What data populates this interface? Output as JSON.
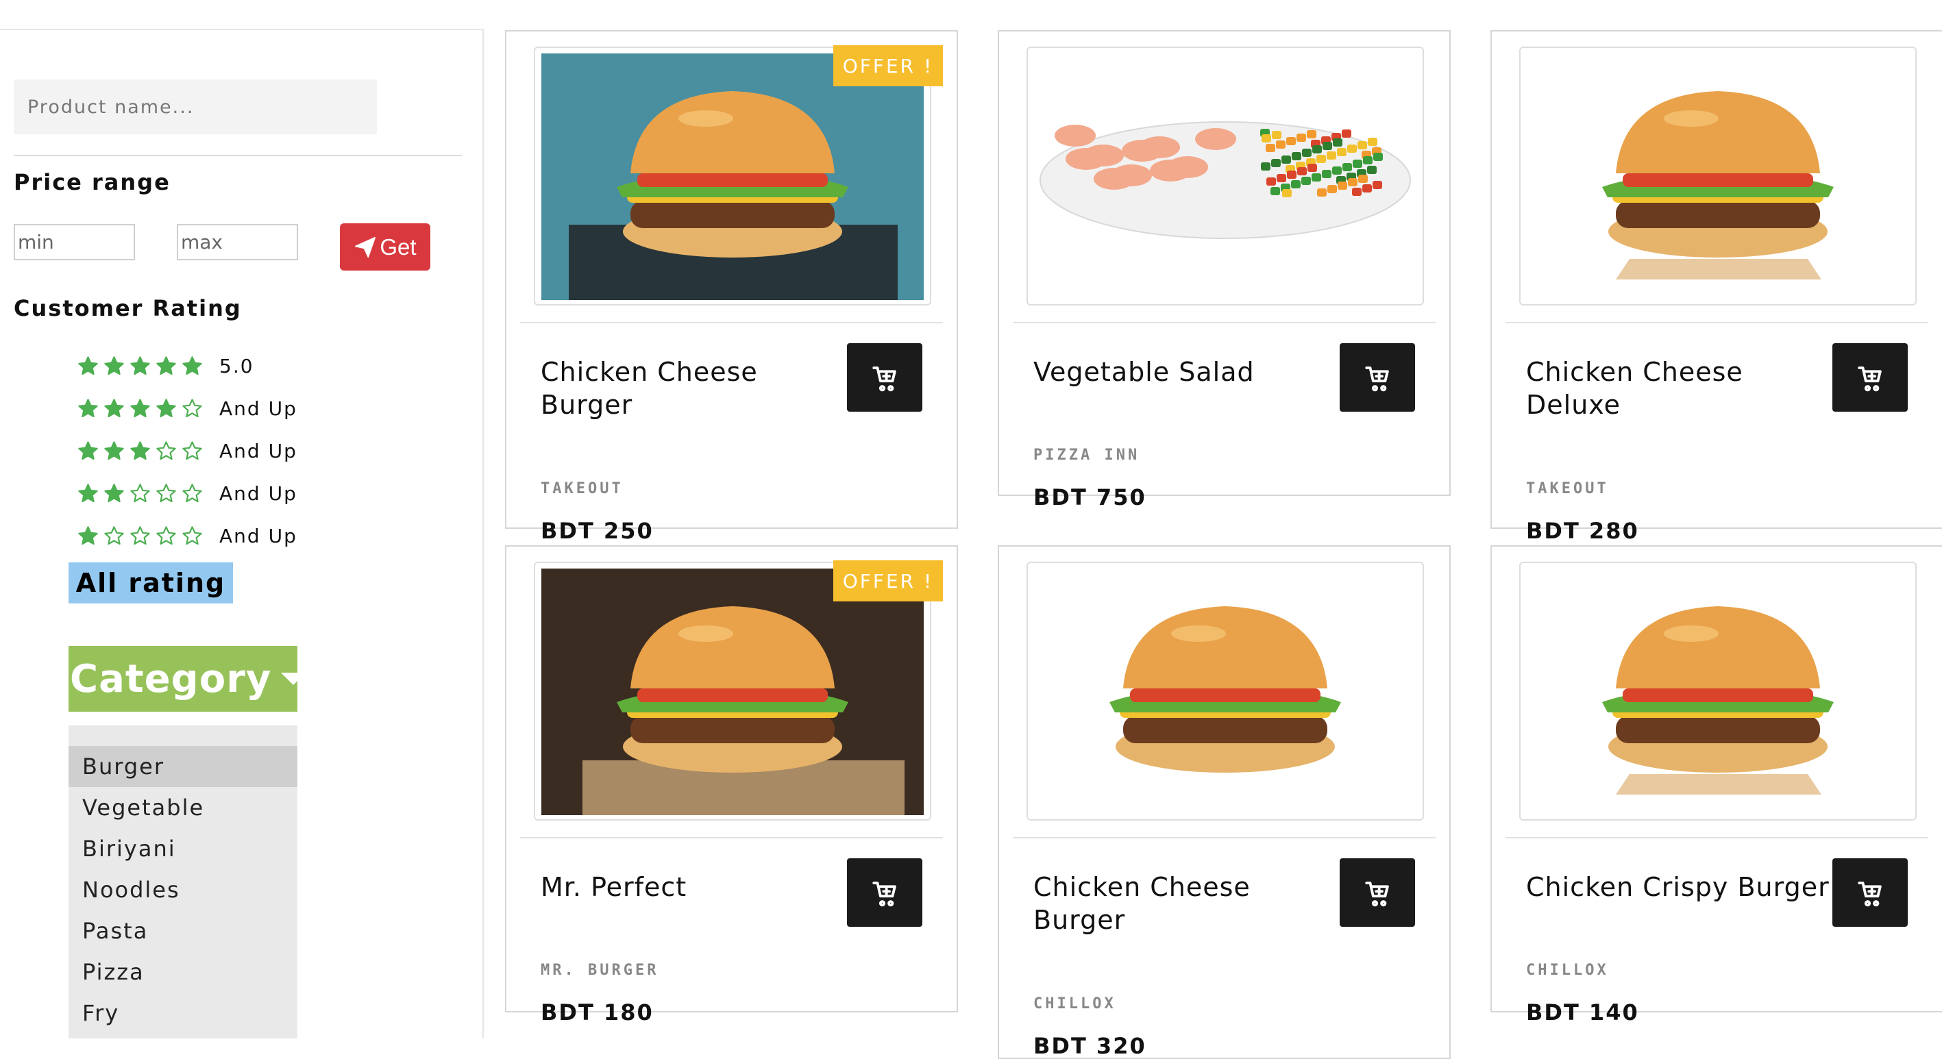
{
  "search": {
    "placeholder": "Product name..."
  },
  "price_range": {
    "title": "Price range",
    "min_placeholder": "min",
    "max_placeholder": "max",
    "button_label": "Get"
  },
  "rating": {
    "title": "Customer Rating",
    "rows": [
      {
        "stars": 5,
        "label": "5.0"
      },
      {
        "stars": 4,
        "label": "And Up"
      },
      {
        "stars": 3,
        "label": "And Up"
      },
      {
        "stars": 2,
        "label": "And Up"
      },
      {
        "stars": 1,
        "label": "And Up"
      }
    ],
    "all_label": "All rating"
  },
  "category": {
    "title": "Category",
    "items": [
      "Burger",
      "Vegetable",
      "Biriyani",
      "Noodles",
      "Pasta",
      "Pizza",
      "Fry"
    ],
    "selected": "Burger"
  },
  "products": [
    {
      "title": "Chicken Cheese Burger",
      "shop": "TAKEOUT",
      "price": "BDT 250",
      "offer": "OFFER !",
      "image": "burger-image"
    },
    {
      "title": "Vegetable Salad",
      "shop": "PIZZA INN",
      "price": "BDT 750",
      "offer": null,
      "image": "salad-image"
    },
    {
      "title": "Chicken Cheese Deluxe",
      "shop": "TAKEOUT",
      "price": "BDT 280",
      "offer": null,
      "image": "burger-image"
    },
    {
      "title": "Mr. Perfect",
      "shop": "MR. BURGER",
      "price": "BDT 180",
      "offer": "OFFER !",
      "image": "burger-image"
    },
    {
      "title": "Chicken Cheese Burger",
      "shop": "CHILLOX",
      "price": "BDT 320",
      "offer": null,
      "image": "burger-image"
    },
    {
      "title": "Chicken Crispy Burger",
      "shop": "CHILLOX",
      "price": "BDT 140",
      "offer": null,
      "image": "burger-image"
    }
  ],
  "icons": {
    "cart": "add-to-cart-icon",
    "send": "paper-plane-icon",
    "star": "star-icon",
    "caret": "caret-down-icon"
  },
  "colors": {
    "accent_red": "#d9393e",
    "star_green": "#4caf50",
    "offer_yellow": "#f6bd2d",
    "category_green": "#97c25a",
    "all_rating_blue": "#93c9f0"
  }
}
